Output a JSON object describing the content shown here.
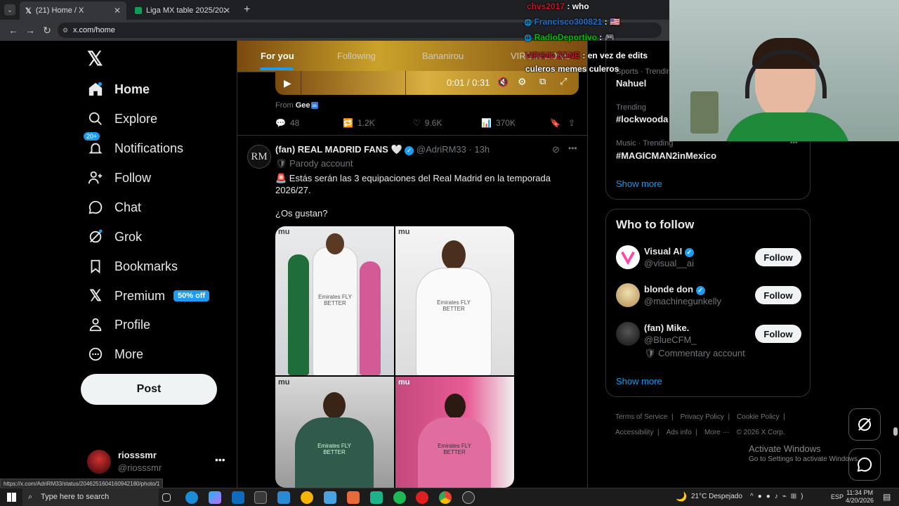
{
  "browser": {
    "tabs": [
      {
        "title": "(21) Home / X"
      },
      {
        "title": "Liga MX table 2025/2026 - Clas"
      }
    ],
    "url": "x.com/home",
    "status_url": "https://x.com/AdriRM33/status/2046251604160942180/photo/1"
  },
  "nav": {
    "items": [
      {
        "label": "Home",
        "icon": "home-icon"
      },
      {
        "label": "Explore",
        "icon": "search-icon"
      },
      {
        "label": "Notifications",
        "icon": "bell-icon"
      },
      {
        "label": "Follow",
        "icon": "person-plus-icon"
      },
      {
        "label": "Chat",
        "icon": "chat-icon"
      },
      {
        "label": "Grok",
        "icon": "grok-icon"
      },
      {
        "label": "Bookmarks",
        "icon": "bookmark-icon"
      },
      {
        "label": "Premium",
        "icon": "x-icon"
      },
      {
        "label": "Profile",
        "icon": "person-icon"
      },
      {
        "label": "More",
        "icon": "more-circle-icon"
      }
    ],
    "notif_badge": "20+",
    "premium_badge": "50% off",
    "post": "Post"
  },
  "account": {
    "name": "riosssmr",
    "handle": "@riosssmr"
  },
  "feed": {
    "tabs": [
      "For you",
      "Following",
      "Bananirou",
      "VIRGIN ZONE"
    ],
    "video": {
      "time": "0:01 / 0:31",
      "from_label": "From",
      "from_name": "Gee"
    },
    "prev_stats": {
      "replies": "48",
      "reposts": "1.2K",
      "likes": "9.6K",
      "views": "370K"
    },
    "post": {
      "author": "(fan) REAL MADRID FANS",
      "handle": "@AdriRM33",
      "time": "13h",
      "label": "Parody account",
      "text1": "🚨 Estás serán las 3 equipaciones del Real Madrid en la temporada 2026/27.",
      "text2": "¿Os gustan?",
      "avatar_text": "RM",
      "photo_watermark": "mu",
      "kit_text": "Emirates FLY BETTER"
    }
  },
  "trends": [
    {
      "category": "Sports · Trending",
      "name": "Nahuel"
    },
    {
      "category": "Trending",
      "name": "#lockwooda"
    },
    {
      "category": "Music · Trending",
      "name": "#MAGICMAN2inMexico"
    }
  ],
  "show_more": "Show more",
  "who_to_follow": {
    "title": "Who to follow",
    "users": [
      {
        "name": "Visual AI",
        "handle": "@visual__ai",
        "verified": true,
        "note": ""
      },
      {
        "name": "blonde don",
        "handle": "@machinegunkelly",
        "verified": true,
        "note": ""
      },
      {
        "name": "(fan) Mike.",
        "handle": "@BlueCFM_",
        "verified": false,
        "note": "Commentary account"
      }
    ],
    "follow_label": "Follow"
  },
  "footer": {
    "line1": [
      "Terms of Service",
      "Privacy Policy",
      "Cookie Policy"
    ],
    "line2": [
      "Accessibility",
      "Ads info",
      "More ···",
      "© 2026 X Corp."
    ]
  },
  "chat_overlay": [
    {
      "user": "chvs2017",
      "msg": "who",
      "color": "#c4162a"
    },
    {
      "user": "Francisco300821",
      "msg": "🇺🇸",
      "color": "#1f6fd1"
    },
    {
      "user": "RadioDeportivo",
      "msg": "🎮",
      "color": "#00c000"
    },
    {
      "user": "VIRGIN ZONE",
      "msg": "en vez de edits culeros memes culeros",
      "color": "#c4162a"
    }
  ],
  "activate": {
    "title": "Activate Windows",
    "sub": "Go to Settings to activate Windows."
  },
  "taskbar": {
    "search": "Type here to search",
    "weather": "21°C Despejado",
    "lang": "ESP",
    "time": "11:34 PM",
    "date": "4/20/2026"
  },
  "colors": {
    "accent": "#1d9bf0",
    "verified": "#1d9bf0",
    "bg": "#000000"
  }
}
